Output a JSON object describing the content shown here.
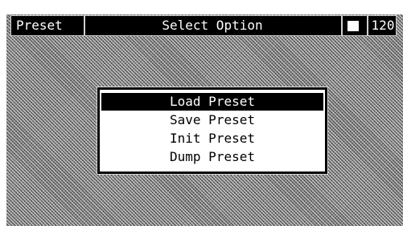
{
  "header": {
    "section_label": "Preset",
    "title": "Select Option",
    "tempo": "120"
  },
  "menu": {
    "items": [
      {
        "label": "Load Preset",
        "selected": true
      },
      {
        "label": "Save Preset",
        "selected": false
      },
      {
        "label": "Init Preset",
        "selected": false
      },
      {
        "label": "Dump Preset",
        "selected": false
      }
    ]
  },
  "colors": {
    "bar_background": "#000000",
    "text_light": "#ffffff",
    "menu_background": "#ffffff",
    "highlight": "#000000"
  },
  "icons": {
    "status_square": "stop-square-icon"
  }
}
